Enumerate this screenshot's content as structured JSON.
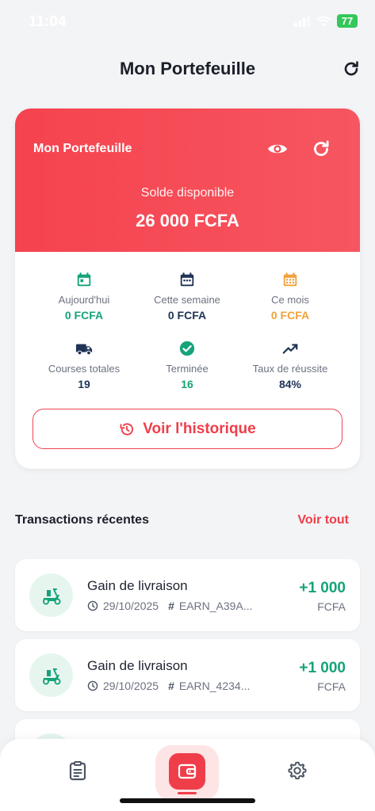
{
  "status": {
    "time": "11:04",
    "battery": "77"
  },
  "header": {
    "title": "Mon Portefeuille"
  },
  "wallet": {
    "name": "Mon Portefeuille",
    "balance_label": "Solde disponible",
    "balance": "26 000 FCFA",
    "accent": "#f5434f"
  },
  "stats": [
    {
      "label": "Aujourd'hui",
      "value": "0 FCFA",
      "icon": "calendar-today-icon",
      "color": "#16a37a"
    },
    {
      "label": "Cette semaine",
      "value": "0 FCFA",
      "icon": "calendar-week-icon",
      "color": "#1e3356"
    },
    {
      "label": "Ce mois",
      "value": "0 FCFA",
      "icon": "calendar-month-icon",
      "color": "#f2a13b"
    },
    {
      "label": "Courses totales",
      "value": "19",
      "icon": "truck-icon",
      "color": "#1e3356"
    },
    {
      "label": "Terminée",
      "value": "16",
      "icon": "check-circle-icon",
      "color": "#16a37a"
    },
    {
      "label": "Taux de réussite",
      "value": "84%",
      "icon": "trending-up-icon",
      "color": "#1e3356"
    }
  ],
  "history_button": "Voir l'historique",
  "transactions": {
    "title": "Transactions récentes",
    "see_all": "Voir tout",
    "items": [
      {
        "title": "Gain de livraison",
        "date": "29/10/2025",
        "ref": "EARN_A39A...",
        "amount": "+1 000",
        "currency": "FCFA"
      },
      {
        "title": "Gain de livraison",
        "date": "29/10/2025",
        "ref": "EARN_4234...",
        "amount": "+1 000",
        "currency": "FCFA"
      }
    ]
  },
  "nav": {
    "items": [
      "orders-icon",
      "wallet-icon",
      "settings-icon"
    ],
    "active": "wallet-icon"
  }
}
